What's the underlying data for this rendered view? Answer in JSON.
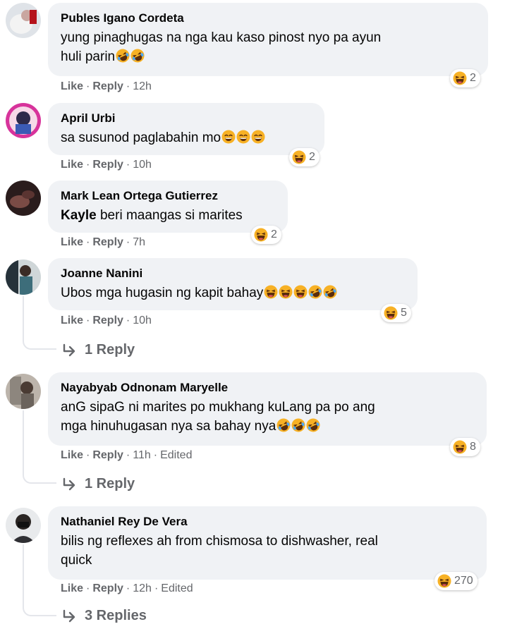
{
  "actions": {
    "like": "Like",
    "reply": "Reply",
    "separator": "·"
  },
  "comments": [
    {
      "author": "Publes Igano Cordeta",
      "line1": "yung pinaghugas na nga kau kaso pinost nyo pa ayun",
      "line2": "huli parin",
      "reaction_count": "2",
      "time": "12h",
      "edited": ""
    },
    {
      "author": "April Urbi",
      "line1": "sa susunod paglabahin mo",
      "reaction_count": "2",
      "time": "10h",
      "edited": ""
    },
    {
      "author": "Mark Lean Ortega Gutierrez",
      "mention": "Kayle",
      "line1": " beri maangas si marites",
      "reaction_count": "2",
      "time": "7h",
      "edited": ""
    },
    {
      "author": "Joanne Nanini",
      "line1": "Ubos mga hugasin ng kapit bahay",
      "reaction_count": "5",
      "time": "10h",
      "edited": "",
      "replies": "1 Reply"
    },
    {
      "author": "Nayabyab Odnonam Maryelle",
      "line1": "anG sipaG ni marites po mukhang kuLang pa po ang",
      "line2": "mga hinuhugasan nya sa bahay nya",
      "reaction_count": "8",
      "time": "11h",
      "edited": "Edited",
      "replies": "1 Reply"
    },
    {
      "author": "Nathaniel Rey De Vera",
      "line1": "bilis ng reflexes ah from chismosa to dishwasher, real",
      "line2": "quick",
      "reaction_count": "270",
      "time": "12h",
      "edited": "Edited",
      "replies": "3 Replies"
    }
  ],
  "icons": {
    "reaction": "laughing-emoji-icon",
    "reply_arrow": "reply-arrow-icon",
    "emoji_rofl": "rofl-emoji-icon",
    "emoji_grin": "grinning-squint-emoji-icon",
    "emoji_laugh": "laughing-emoji-icon"
  },
  "colors": {
    "bubble": "#f0f2f5",
    "meta": "#65676b",
    "emoji_yellow": "#f7b125",
    "mouth": "#5a2d0c"
  }
}
